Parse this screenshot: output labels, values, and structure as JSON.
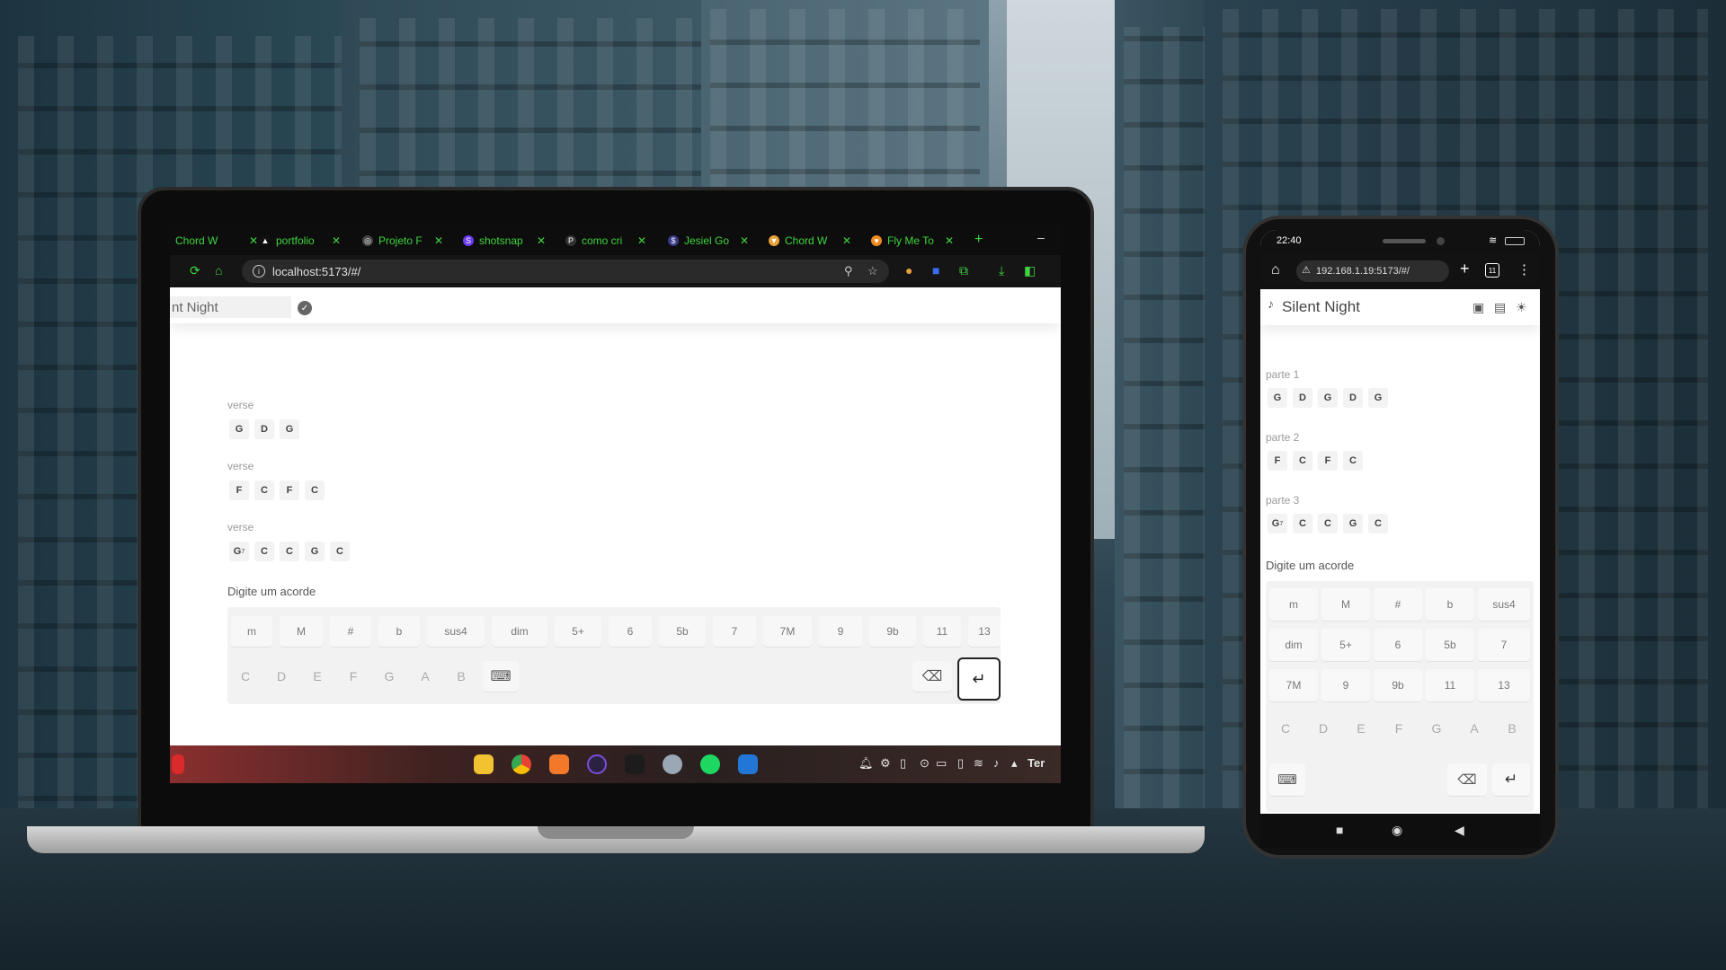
{
  "laptop": {
    "tabs": [
      {
        "label": "Chord W",
        "favicon": "",
        "color": "#3fd53f"
      },
      {
        "label": "portfolio",
        "favicon": "▲",
        "color": "#ffffff"
      },
      {
        "label": "Projeto F",
        "favicon": "◎",
        "color": "#cccccc"
      },
      {
        "label": "shotsnap",
        "favicon": "S",
        "color": "#6b3cf0"
      },
      {
        "label": "como cri",
        "favicon": "P",
        "color": "#2a2a2a"
      },
      {
        "label": "Jesiel Go",
        "favicon": "$",
        "color": "#3a3a88"
      },
      {
        "label": "Chord W",
        "favicon": "▼",
        "color": "#e8a23a"
      },
      {
        "label": "Fly Me To",
        "favicon": "♥",
        "color": "#f08a1f"
      }
    ],
    "new_tab": "+",
    "minimize": "–",
    "url": "localhost:5173/#/",
    "song_title": "nt Night",
    "sections": [
      {
        "label": "verse",
        "chords": [
          "G",
          "D",
          "G"
        ]
      },
      {
        "label": "verse",
        "chords": [
          "F",
          "C",
          "F",
          "C"
        ]
      },
      {
        "label": "verse",
        "chords": [
          "G",
          "C",
          "C",
          "G",
          "C"
        ],
        "first_sup": "7"
      }
    ],
    "prompt": "Digite um acorde",
    "modifiers": [
      "m",
      "M",
      "#",
      "b",
      "sus4",
      "dim",
      "5+",
      "6",
      "5b",
      "7",
      "7M",
      "9",
      "9b",
      "11",
      "13"
    ],
    "notes": [
      "C",
      "D",
      "E",
      "F",
      "G",
      "A",
      "B"
    ],
    "enter": "↵",
    "backspace": "⌫",
    "keyboard_toggle": "⌨",
    "tray_text": "Ter"
  },
  "phone": {
    "time": "22:40",
    "url": "192.168.1.19:5173/#/",
    "tab_count": "11",
    "song_title": "Silent Night",
    "sections": [
      {
        "label": "parte 1",
        "chords": [
          "G",
          "D",
          "G",
          "D",
          "G"
        ]
      },
      {
        "label": "parte 2",
        "chords": [
          "F",
          "C",
          "F",
          "C"
        ]
      },
      {
        "label": "parte 3",
        "chords": [
          "G",
          "C",
          "C",
          "G",
          "C"
        ],
        "first_sup": "7"
      }
    ],
    "prompt": "Digite um acorde",
    "modifiers": [
      "m",
      "M",
      "#",
      "b",
      "sus4",
      "dim",
      "5+",
      "6",
      "5b",
      "7",
      "7M",
      "9",
      "9b",
      "11",
      "13"
    ],
    "notes": [
      "C",
      "D",
      "E",
      "F",
      "G",
      "A",
      "B"
    ],
    "enter": "↵",
    "backspace": "⌫",
    "keyboard_toggle": "⌨"
  },
  "colors": {
    "tab_text": "#3fd53f",
    "chord_bg": "#f3f3f3",
    "keyboard_bg": "#f2f2f2"
  }
}
